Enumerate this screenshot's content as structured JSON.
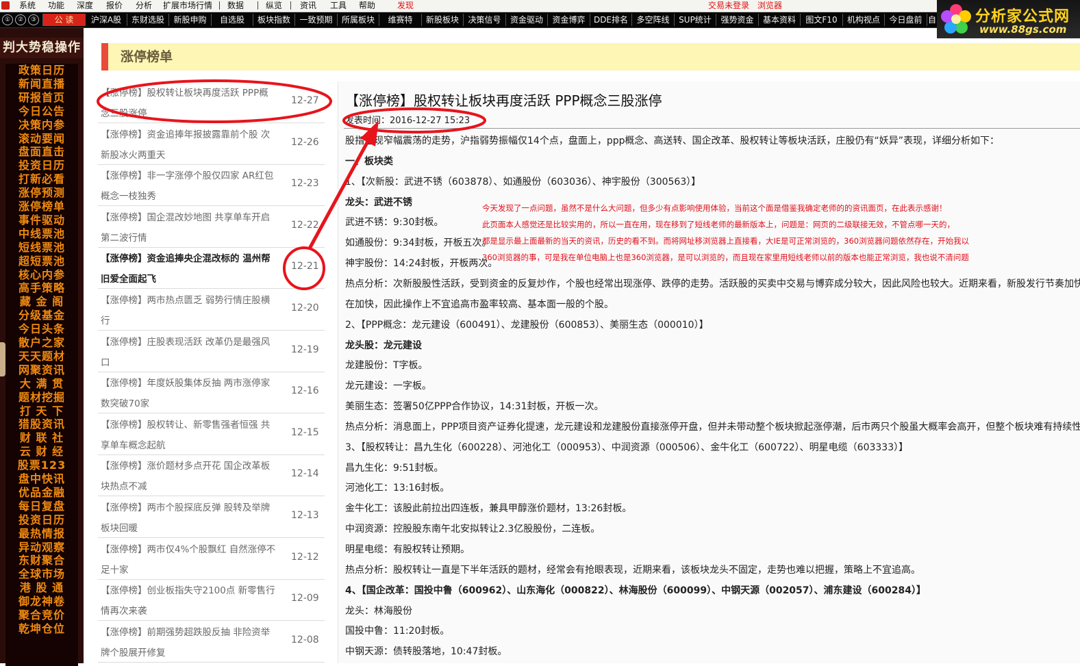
{
  "menubar": {
    "items": [
      "系统",
      "功能",
      "深度",
      "报价",
      "分析",
      "扩展市场行情",
      "数据",
      "纵览",
      "资讯",
      "工具",
      "帮助",
      "发现"
    ],
    "status_login": "交易未登录",
    "status_browser": "浏览器"
  },
  "toolbar": {
    "numbers": [
      "①",
      "②",
      "③"
    ],
    "tabs": [
      "公 读",
      "沪深A股",
      "东财选股",
      "新股申购",
      "自选股",
      "板块指数",
      "一致预期",
      "所属板块",
      "维赛特",
      "新股板块",
      "决策信号",
      "资金驱动",
      "资金博弈",
      "DDE排名",
      "多空阵线",
      "SUP统计",
      "强势资金",
      "基本资料",
      "图文F10",
      "机构视点",
      "今日盘前",
      "自"
    ]
  },
  "logo": {
    "name": "分析家公式网",
    "url": "www.88gs.com"
  },
  "sidebar": {
    "title": "判大势稳操作",
    "items": [
      "政策日历",
      "新闻直播",
      "研报首页",
      "今日公告",
      "决策内参",
      "滚动要闻",
      "盘面直击",
      "投资日历",
      "打新必看",
      "涨停预测",
      "涨停榜单",
      "事件驱动",
      "中线票池",
      "短线票池",
      "超短票池",
      "核心内参",
      "高手策略",
      "藏 金 阁",
      "分级基金",
      "今日头条",
      "散户之家",
      "天天题材",
      "网聚资讯",
      "大 满 贯",
      "题材挖掘",
      "打 天 下",
      "猎股资讯",
      "财 联 社",
      "云 财 经",
      "股票123",
      "盘中快讯",
      "优品金融",
      "每日复盘",
      "投资日历",
      "最热情报",
      "异动观察",
      "东财聚合",
      "全球市场",
      "港 股 通",
      "御龙神卷",
      "聚合竞价",
      "乾坤仓位"
    ]
  },
  "section": {
    "title": "涨停榜单"
  },
  "news_list": [
    {
      "title": "【涨停榜】股权转让板块再度活跃 PPP概念三股涨停",
      "date": "12-27"
    },
    {
      "title": "【涨停榜】资金追捧年报披露靠前个股 次新股冰火两重天",
      "date": "12-26"
    },
    {
      "title": "【涨停榜】非一字涨停个股仅四家 AR红包概念一枝独秀",
      "date": "12-23"
    },
    {
      "title": "【涨停榜】国企混改妙地图 共享单车开启第二波行情",
      "date": "12-22"
    },
    {
      "title": "【涨停榜】资金追捧央企混改标的 温州帮旧爱全面起飞",
      "date": "12-21"
    },
    {
      "title": "【涨停榜】两市热点匮乏 弱势行情庄股横行",
      "date": "12-20"
    },
    {
      "title": "【涨停榜】庄股表现活跃 改革仍是最强风口",
      "date": "12-19"
    },
    {
      "title": "【涨停榜】年度妖股集体反抽 两市涨停家数突破70家",
      "date": "12-16"
    },
    {
      "title": "【涨停榜】股权转让、新零售强者恒强 共享单车概念起航",
      "date": "12-15"
    },
    {
      "title": "【涨停榜】涨价题材多点开花 国企改革板块热点不减",
      "date": "12-14"
    },
    {
      "title": "【涨停榜】两市个股探底反弹 股转及举牌板块回暖",
      "date": "12-13"
    },
    {
      "title": "【涨停榜】两市仅4%个股飘红 自然涨停不足十家",
      "date": "12-12"
    },
    {
      "title": "【涨停榜】创业板指失守2100点 新零售行情再次来袭",
      "date": "12-09"
    },
    {
      "title": "【涨停榜】前期强势超跌股反抽 非险资举牌个股展开修复",
      "date": "12-08"
    }
  ],
  "article": {
    "headline": "【涨停榜】股权转让板块再度活跃 PPP概念三股涨停",
    "pubtime": "发表时间：2016-12-27 15:23",
    "lines": [
      "股指呈现窄幅震荡的走势，沪指弱势振幅仅14个点，盘面上，ppp概念、高送转、国企改革、股权转让等板块活跃，庄股仍有“妖异”表现，详细分析如下：",
      "一、板块类",
      "1、【次新股：武进不锈（603878）、如通股份（603036）、神宇股份（300563）】",
      "龙头：武进不锈",
      "武进不锈：9:30封板。",
      "如通股份：9:34封板，开板五次。",
      "神宇股份：14:24封板，开板两次。",
      "热点分析：次新股股性活跃，受到资金的反复炒作，个股也经常出现涨停、跌停的走势。活跃股的买卖中交易与博弈成分较大，因此风险也较大。近期来看，新股发行节奏加快",
      "在加快，因此操作上不宜追高市盈率较高、基本面一般的个股。",
      "2、【PPP概念：龙元建设（600491）、龙建股份（600853）、美丽生态（000010）】",
      "龙头股：龙元建设",
      "龙建股份：T字板。",
      "龙元建设：一字板。",
      "美丽生态：签署50亿PPP合作协议，14:31封板，开板一次。",
      "热点分析：消息面上，PPP项目资产证券化提速，龙元建设和龙建股份直接涨停开盘，但并未带动整个板块掀起涨停潮，后市两只个股虽大概率会高开，但整个板块难有持续性",
      "3、【股权转让：昌九生化（600228）、河池化工（000953）、中润资源（000506）、金牛化工（600722）、明星电缆（603333）】",
      "昌九生化：9:51封板。",
      "河池化工：13:16封板。",
      "金牛化工：该股此前拉出四连板，兼具甲醇涨价题材，13:26封板。",
      "中润资源：控股股东南午北安拟转让2.3亿股股份，二连板。",
      "明星电缆：有股权转让预期。",
      "热点分析：股权转让一直是下半年活跃的题材，经常会有抢眼表现，近期来看，该板块龙头不固定，走势也难以把握，策略上不宜追高。",
      "4、【国企改革：国投中鲁（600962）、山东海化（000822）、林海股份（600099）、中钢天源（002057）、浦东建设（600284）】",
      "龙头：林海股份",
      "国投中鲁：11:20封板。",
      "中钢天源：债转股落地，10:47封板。"
    ]
  },
  "overlay_note": [
    "今天发现了一点问题，虽然不是什么大问题，但多少有点影响使用体验，当前这个面是借鉴我确定老师的的资讯面页，在此表示感谢！",
    "此页面本人感觉还是比较实用的，所以一直在用，现在移到了短线老师的最新版本上，问题是：网页的二级联接无效，不管点哪一天的，",
    "都是显示最上面最新的当天的资讯，历史的看不到。而将网址移浏览器上直接看，大IE是可正常浏览的，360浏览器问题依然存在，开始我以",
    "360浏览器的事，可是我在单位电脑上也是360浏览器，是可以浏览的，而且现在家里用短线老师以前的版本也能正常浏览，我也说不清问题"
  ],
  "colors": {
    "accent": "#d8231a",
    "annotation": "#e8141c",
    "sidebar_text": "#f08a10",
    "header_bg": "#fdf6b4"
  }
}
